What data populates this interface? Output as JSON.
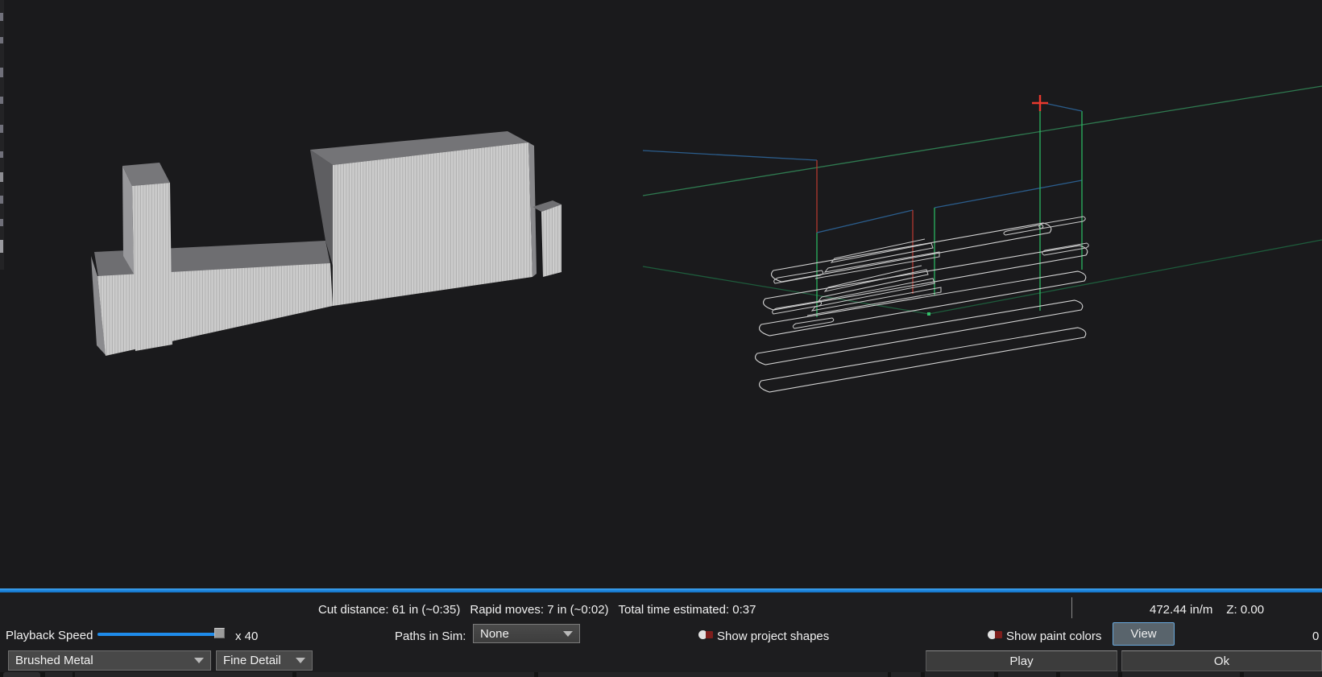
{
  "status_bar": {
    "cut_distance": "Cut distance: 61 in (~0:35)",
    "rapid_moves": "Rapid moves: 7 in (~0:02)",
    "total_time": "Total time estimated: 0:37",
    "feed_rate": "472.44 in/m",
    "z_readout": "Z: 0.00"
  },
  "playback_row": {
    "speed_label": "Playback Speed",
    "speed_multiplier": "x 40",
    "paths_label": "Paths in Sim:",
    "paths_value": "None",
    "show_project_shapes_label": "Show project shapes",
    "show_paint_colors_label": "Show paint colors",
    "view_button_label": "View",
    "edge_overflow_text": "0"
  },
  "bottom_row": {
    "material_value": "Brushed Metal",
    "detail_value": "Fine Detail",
    "play_button_label": "Play",
    "ok_button_label": "Ok"
  },
  "scene": {
    "model": "stepped-block-3d-render",
    "overlay": "toolpath-wireframe",
    "colors": {
      "accent_blue": "#1f8ceb",
      "toolpath_green_bright": "#2fb463",
      "toolpath_green_dark": "#1e5c3c",
      "toolpath_blue": "#2b5d8c",
      "toolpath_red": "#b23830",
      "crosshair_red": "#e8392e",
      "outline_white": "#d2d2d2",
      "toggle_red": "#7e1f1d"
    }
  }
}
